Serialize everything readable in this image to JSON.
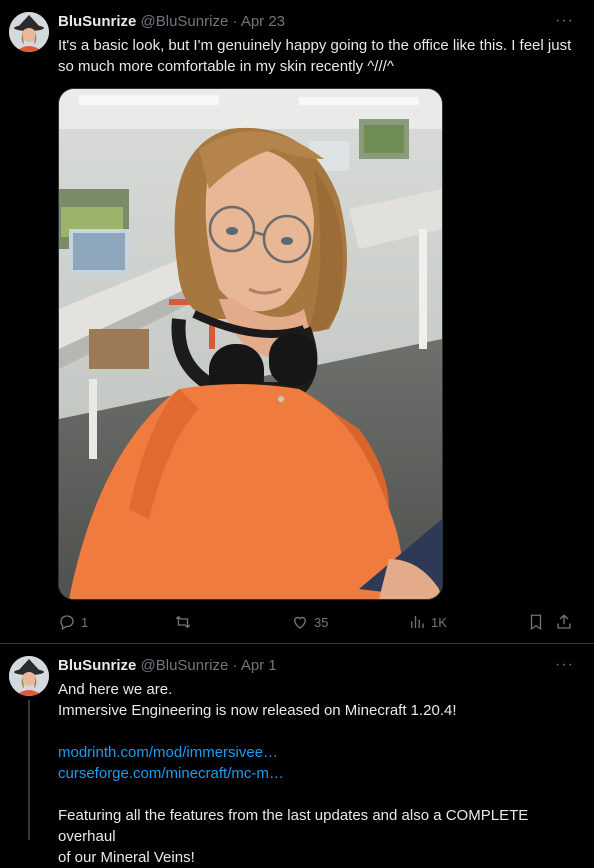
{
  "tweets": [
    {
      "author_name": "BluSunrize",
      "handle": "@BluSunrize",
      "separator": "·",
      "date": "Apr 23",
      "more": "···",
      "lines": [
        "It's a basic look, but I'm genuinely happy going to the office like this. I feel just",
        "so much more comfortable in my skin recently ^///^"
      ],
      "actions": {
        "replies": "1",
        "retweets": "",
        "likes": "35",
        "views": "1K"
      }
    },
    {
      "author_name": "BluSunrize",
      "handle": "@BluSunrize",
      "separator": "·",
      "date": "Apr 1",
      "more": "···",
      "lines": [
        "And here we are.",
        "Immersive Engineering is now released on Minecraft 1.20.4!",
        "",
        "modrinth.com/mod/immersivee…",
        "curseforge.com/minecraft/mc-m…",
        "",
        "Featuring all the features from the last updates and also a COMPLETE overhaul",
        "of our Mineral Veins!"
      ]
    }
  ],
  "colors": {
    "link": "#1d9bf0",
    "muted": "#71767b",
    "shirt": "#f07b3f"
  },
  "icons": [
    "reply-icon",
    "retweet-icon",
    "like-icon",
    "views-icon",
    "bookmark-icon",
    "share-icon",
    "more-icon"
  ]
}
